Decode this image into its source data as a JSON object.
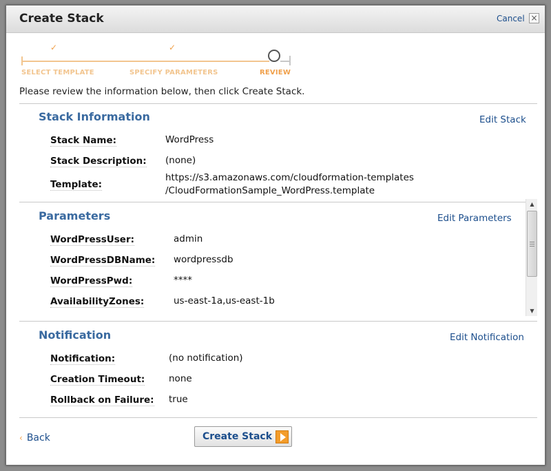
{
  "dialog": {
    "title": "Create Stack",
    "cancel_label": "Cancel",
    "close_glyph": "×"
  },
  "wizard": {
    "steps": [
      {
        "label": "SELECT TEMPLATE",
        "state": "done"
      },
      {
        "label": "SPECIFY PARAMETERS",
        "state": "done"
      },
      {
        "label": "REVIEW",
        "state": "current"
      }
    ],
    "check_glyph": "✓",
    "colors": {
      "done": "#f2c58f",
      "current": "#f0a04b"
    }
  },
  "intro_text": "Please review the information below, then click Create Stack.",
  "stack_information": {
    "title": "Stack Information",
    "edit_label": "Edit Stack",
    "rows": [
      {
        "label": "Stack Name:",
        "value": "WordPress"
      },
      {
        "label": "Stack Description:",
        "value": "(none)"
      },
      {
        "label": "Template:",
        "value_line1": "https://s3.amazonaws.com/cloudformation-templates",
        "value_line2": "/CloudFormationSample_WordPress.template"
      }
    ]
  },
  "parameters": {
    "title": "Parameters",
    "edit_label": "Edit Parameters",
    "rows": [
      {
        "label": "WordPressUser:",
        "value": "admin"
      },
      {
        "label": "WordPressDBName:",
        "value": "wordpressdb"
      },
      {
        "label": "WordPressPwd:",
        "value": "****"
      },
      {
        "label": "AvailabilityZones:",
        "value": "us-east-1a,us-east-1b"
      }
    ],
    "scroll_up_glyph": "▲",
    "scroll_down_glyph": "▼"
  },
  "notification": {
    "title": "Notification",
    "edit_label": "Edit Notification",
    "rows": [
      {
        "label": "Notification:",
        "value": "(no notification)"
      },
      {
        "label": "Creation Timeout:",
        "value": "none"
      },
      {
        "label": "Rollback on Failure:",
        "value": "true"
      }
    ]
  },
  "footer": {
    "back_glyph": "‹",
    "back_label": "Back",
    "create_label": "Create Stack",
    "accent_color": "#f39c2a"
  }
}
